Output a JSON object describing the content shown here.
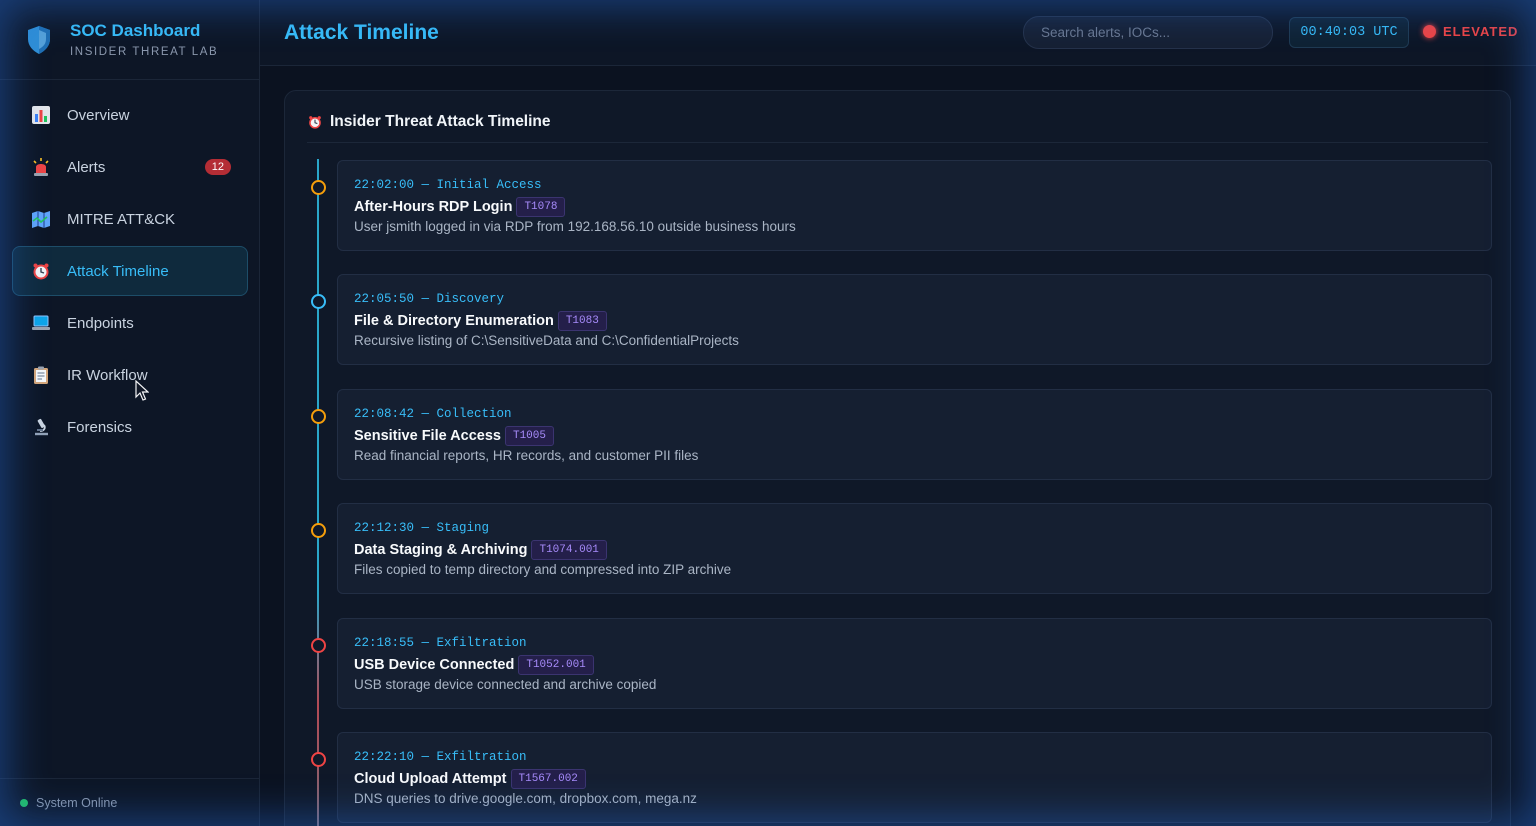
{
  "brand": {
    "title": "SOC Dashboard",
    "subtitle": "INSIDER THREAT LAB"
  },
  "sidebar": {
    "items": [
      {
        "label": "Overview",
        "icon": "bar-chart-icon"
      },
      {
        "label": "Alerts",
        "icon": "siren-icon",
        "badge": "12"
      },
      {
        "label": "MITRE ATT&CK",
        "icon": "map-icon"
      },
      {
        "label": "Attack Timeline",
        "icon": "alarm-clock-icon",
        "active": true
      },
      {
        "label": "Endpoints",
        "icon": "laptop-icon"
      },
      {
        "label": "IR Workflow",
        "icon": "clipboard-icon"
      },
      {
        "label": "Forensics",
        "icon": "microscope-icon"
      }
    ],
    "status": "System Online"
  },
  "header": {
    "title": "Attack Timeline",
    "search_placeholder": "Search alerts, IOCs...",
    "clock": "00:40:03 UTC",
    "threat_level": "ELEVATED"
  },
  "panel": {
    "title": "Insider Threat Attack Timeline",
    "events": [
      {
        "time": "22:02:00 — Initial Access",
        "title": "After-Hours RDP Login",
        "tag": "T1078",
        "desc": "User jsmith logged in via RDP from 192.168.56.10 outside business hours",
        "severity": "medium"
      },
      {
        "time": "22:05:50 — Discovery",
        "title": "File & Directory Enumeration",
        "tag": "T1083",
        "desc": "Recursive listing of C:\\SensitiveData and C:\\ConfidentialProjects",
        "severity": "low"
      },
      {
        "time": "22:08:42 — Collection",
        "title": "Sensitive File Access",
        "tag": "T1005",
        "desc": "Read financial reports, HR records, and customer PII files",
        "severity": "medium"
      },
      {
        "time": "22:12:30 — Staging",
        "title": "Data Staging & Archiving",
        "tag": "T1074.001",
        "desc": "Files copied to temp directory and compressed into ZIP archive",
        "severity": "medium"
      },
      {
        "time": "22:18:55 — Exfiltration",
        "title": "USB Device Connected",
        "tag": "T1052.001",
        "desc": "USB storage device connected and archive copied",
        "severity": "high"
      },
      {
        "time": "22:22:10 — Exfiltration",
        "title": "Cloud Upload Attempt",
        "tag": "T1567.002",
        "desc": "DNS queries to drive.google.com, dropbox.com, mega.nz",
        "severity": "high"
      }
    ]
  },
  "colors": {
    "accent": "#38bdf8",
    "medium": "#f59e0b",
    "low": "#38bdf8",
    "high": "#ef4444",
    "badge": "#b42d35",
    "online": "#22c55e"
  }
}
